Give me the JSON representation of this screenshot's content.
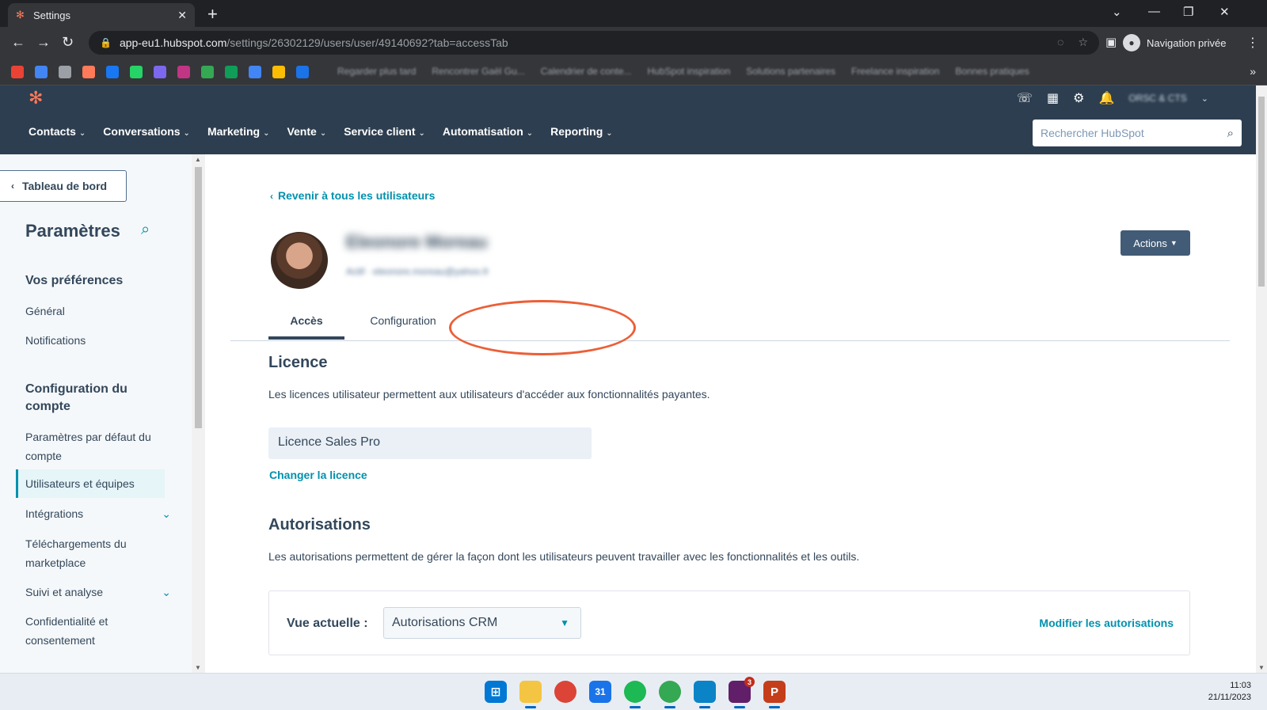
{
  "browser": {
    "tab_title": "Settings",
    "url_host": "app-eu1.hubspot.com",
    "url_path": "/settings/26302129/users/user/49140692?tab=accessTab",
    "profile_label": "Navigation privée",
    "bookmarks": [
      "Regarder plus tard",
      "Rencontrer Gaël Gu...",
      "Calendrier de conte...",
      "HubSpot inspiration",
      "Solutions partenaires",
      "Freelance inspiration",
      "Bonnes pratiques"
    ]
  },
  "hubspot_nav": {
    "items": [
      "Contacts",
      "Conversations",
      "Marketing",
      "Vente",
      "Service client",
      "Automatisation",
      "Reporting"
    ],
    "search_placeholder": "Rechercher HubSpot",
    "account_name": "ORSC & CTS"
  },
  "sidebar": {
    "back_label": "Tableau de bord",
    "title": "Paramètres",
    "sections": [
      {
        "title": "Vos préférences",
        "items": [
          "Général",
          "Notifications"
        ]
      },
      {
        "title": "Configuration du compte",
        "items": [
          "Paramètres par défaut du compte",
          "Utilisateurs et équipes",
          "Intégrations",
          "Téléchargements du marketplace",
          "Suivi et analyse",
          "Confidentialité et consentement"
        ]
      }
    ]
  },
  "main": {
    "back_link": "Revenir à tous les utilisateurs",
    "user_name": "Eleonore Moreau",
    "user_meta": "Actif · eleonore.moreau@yahoo.fr",
    "actions_label": "Actions",
    "tabs": [
      "Accès",
      "Configuration"
    ],
    "licence_heading": "Licence",
    "licence_desc": "Les licences utilisateur permettent aux utilisateurs d'accéder aux fonctionnalités payantes.",
    "licence_value": "Licence Sales Pro",
    "change_licence": "Changer la licence",
    "perm_heading": "Autorisations",
    "perm_desc": "Les autorisations permettent de gérer la façon dont les utilisateurs peuvent travailler avec les fonctionnalités et les outils.",
    "current_view_label": "Vue actuelle :",
    "current_view_value": "Autorisations CRM",
    "modify_perms": "Modifier les autorisations"
  },
  "taskbar": {
    "time": "11:03",
    "date": "21/11/2023",
    "slack_badge": "3",
    "calendar_day": "31"
  },
  "colors": {
    "hubspot_nav": "#2d3e50",
    "link": "#0091ae",
    "annotation": "#ec5f37",
    "actions_button": "#425b76"
  }
}
